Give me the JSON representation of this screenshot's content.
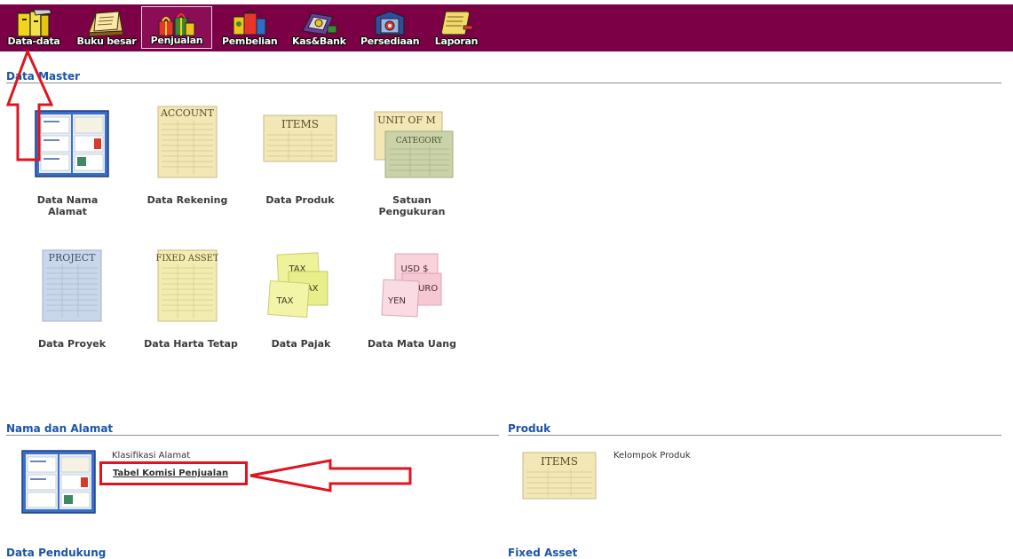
{
  "toolbar": {
    "buttons": [
      {
        "label": "Data-data"
      },
      {
        "label": "Buku besar"
      },
      {
        "label": "Penjualan"
      },
      {
        "label": "Pembelian"
      },
      {
        "label": "Kas&Bank"
      },
      {
        "label": "Persediaan"
      },
      {
        "label": "Laporan"
      }
    ],
    "active_index": 2
  },
  "colors": {
    "toolbar_bg": "#7b0046",
    "section_title": "#1a55a6",
    "annotation_red": "#e0141e"
  },
  "data_master": {
    "title": "Data Master",
    "items": [
      {
        "label": "Data Nama Alamat",
        "icon": "address-cards-icon"
      },
      {
        "label": "Data Rekening",
        "icon_text": "ACCOUNT"
      },
      {
        "label": "Data Produk",
        "icon_text": "ITEMS"
      },
      {
        "label": "Satuan Pengukuran",
        "icon_text": "UNIT OF M",
        "icon_text2": "CATEGORY"
      },
      {
        "label": "Data Proyek",
        "icon_text": "PROJECT"
      },
      {
        "label": "Data Harta Tetap",
        "icon_text": "FIXED ASSET"
      },
      {
        "label": "Data Pajak",
        "icon_text": "TAX",
        "icon_text2": "TAX",
        "icon_text3": "TAX"
      },
      {
        "label": "Data Mata Uang",
        "icon_text": "USD $",
        "icon_text2": "EURO",
        "icon_text3": "YEN"
      }
    ]
  },
  "nama_alamat": {
    "title": "Nama dan Alamat",
    "links": [
      "Klasifikasi Alamat",
      "Tabel Komisi Penjualan"
    ]
  },
  "produk": {
    "title": "Produk",
    "icon_text": "ITEMS",
    "links": [
      "Kelompok Produk"
    ]
  },
  "data_pendukung": {
    "title": "Data Pendukung"
  },
  "fixed_asset": {
    "title": "Fixed Asset"
  }
}
